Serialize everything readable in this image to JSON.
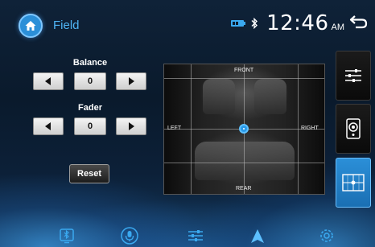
{
  "header": {
    "title": "Field",
    "time": "12:46",
    "ampm": "AM"
  },
  "controls": {
    "balance_label": "Balance",
    "balance_value": "0",
    "fader_label": "Fader",
    "fader_value": "0",
    "reset_label": "Reset"
  },
  "field": {
    "front": "FRONT",
    "rear": "REAR",
    "left": "LEFT",
    "right": "RIGHT"
  },
  "colors": {
    "accent": "#2b8fd8",
    "title": "#4fb4f5"
  },
  "side_tabs": [
    "equalizer-icon",
    "speaker-icon",
    "field-icon"
  ],
  "dock": [
    "bluetooth-phone-icon",
    "microphone-icon",
    "sliders-icon",
    "navigation-icon",
    "settings-icon"
  ]
}
